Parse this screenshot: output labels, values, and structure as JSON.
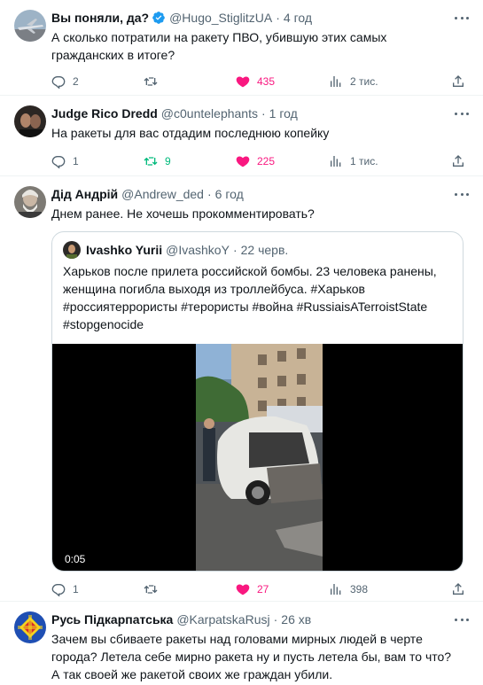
{
  "tweets": [
    {
      "name": "Вы поняли, да?",
      "handle": "@Hugo_StiglitzUA",
      "time": "4 год",
      "text": "А сколько потратили на ракету ПВО, убившую этих самых гражданских в итоге?",
      "replies": "2",
      "retweets": "",
      "likes": "435",
      "views": "2 тис."
    },
    {
      "name": "Judge Rico Dredd",
      "handle": "@c0untelephants",
      "time": "1 год",
      "text": "На ракеты для вас отдадим последнюю копейку",
      "replies": "1",
      "retweets": "9",
      "likes": "225",
      "views": "1 тис."
    },
    {
      "name": "Дід Андрій",
      "handle": "@Andrew_ded",
      "time": "6 год",
      "text": "Днем ранее. Не хочешь прокомментировать?",
      "replies": "1",
      "retweets": "",
      "likes": "27",
      "views": "398",
      "quote": {
        "name": "Ivashko Yurii",
        "handle": "@IvashkoY",
        "time": "22 черв.",
        "text": "Харьков после прилета российской бомбы. 23 человека ранены, женщина погибла выходя из троллейбуса. #Харьков #россиятеррористы #терористы #война #RussiaisATerroistState #stopgenocide",
        "video_duration": "0:05"
      }
    },
    {
      "name": "Русь Підкарпатська",
      "handle": "@KarpatskaRusj",
      "time": "26 хв",
      "text": "Зачем вы сбиваете ракеты над головами мирных людей в черте города? Летела себе мирно ракета ну и пусть летела бы, вам то что? А так своей же ракетой своих же граждан убили."
    }
  ],
  "colors": {
    "like": "#f91880",
    "retweet_active": "#00ba7c",
    "secondary_text": "#536471",
    "verified": "#1d9bf0"
  },
  "icons": [
    "reply-icon",
    "retweet-icon",
    "heart-icon",
    "views-icon",
    "share-icon",
    "verified-icon",
    "more-icon"
  ]
}
